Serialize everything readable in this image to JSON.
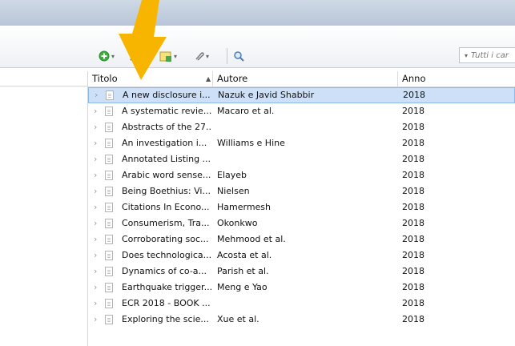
{
  "toolbar": {
    "search_placeholder": "Tutti i car"
  },
  "columns": {
    "title": "Titolo",
    "author": "Autore",
    "year": "Anno",
    "sort_indicator": "▲"
  },
  "rows": [
    {
      "title": "A new disclosure i...",
      "author": "Nazuk e Javid Shabbir",
      "year": "2018",
      "selected": true
    },
    {
      "title": "A systematic revie...",
      "author": "Macaro et al.",
      "year": "2018"
    },
    {
      "title": "Abstracts of the 27...",
      "author": "",
      "year": "2018"
    },
    {
      "title": "An investigation i...",
      "author": "Williams e Hine",
      "year": "2018"
    },
    {
      "title": "Annotated Listing ...",
      "author": "",
      "year": "2018"
    },
    {
      "title": "Arabic word sense...",
      "author": "Elayeb",
      "year": "2018"
    },
    {
      "title": "Being Boethius: Vi...",
      "author": "Nielsen",
      "year": "2018"
    },
    {
      "title": "Citations In Econo...",
      "author": "Hamermesh",
      "year": "2018"
    },
    {
      "title": "Consumerism, Tra...",
      "author": "Okonkwo",
      "year": "2018"
    },
    {
      "title": "Corroborating soc...",
      "author": "Mehmood et al.",
      "year": "2018"
    },
    {
      "title": "Does technologica...",
      "author": "Acosta et al.",
      "year": "2018"
    },
    {
      "title": "Dynamics of co-a...",
      "author": "Parish et al.",
      "year": "2018"
    },
    {
      "title": "Earthquake trigger...",
      "author": "Meng e Yao",
      "year": "2018"
    },
    {
      "title": "ECR 2018 - BOOK ...",
      "author": "",
      "year": "2018"
    },
    {
      "title": "Exploring the scie...",
      "author": "Xue et al.",
      "year": "2018"
    }
  ],
  "colors": {
    "selection": "#cde0f7",
    "arrow": "#f7b500"
  }
}
